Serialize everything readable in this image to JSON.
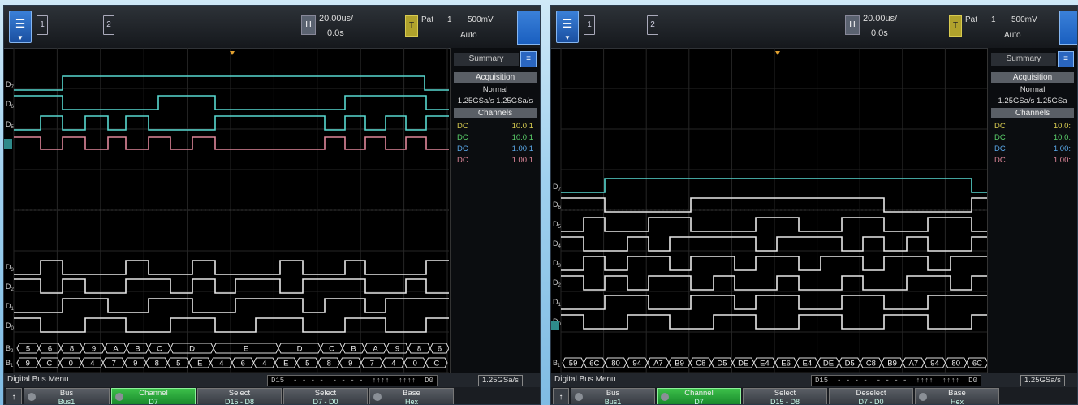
{
  "colors": {
    "d_high": "#58d8d0",
    "d_low_white": "#e8e8e8",
    "pink": "#e0879a",
    "ch1_yellow": "#d8cc50",
    "ch2_green": "#5acf6a",
    "ch3_blue": "#5aa8e8",
    "ch4_pink": "#e0879a"
  },
  "left": {
    "ch_tab1": "1",
    "ch_tab2": "2",
    "h_badge": "H",
    "h_timebase": "20.00us/",
    "h_delay": "0.0s",
    "t_badge": "T",
    "trig_type": "Pat",
    "trig_ch": "1",
    "trig_level": "500mV",
    "trig_mode": "Auto",
    "side": {
      "summary_tab": "Summary",
      "acq_head": "Acquisition",
      "acq_mode": "Normal",
      "acq_rate": "1.25GSa/s 1.25GSa/s",
      "chan_head": "Channels",
      "channels": [
        {
          "coupling": "DC",
          "probe": "10.0:1"
        },
        {
          "coupling": "DC",
          "probe": "10.0:1"
        },
        {
          "coupling": "DC",
          "probe": "1.00:1"
        },
        {
          "coupling": "DC",
          "probe": "1.00:1"
        }
      ]
    },
    "digital_labels_top": [
      "D7",
      "D6",
      "D5"
    ],
    "digital_labels_bottom": [
      "D3",
      "D2",
      "D1",
      "D0"
    ],
    "bus_labels": [
      "B2",
      "B1"
    ],
    "bus2_values": [
      "5",
      "6",
      "8",
      "9",
      "A",
      "B",
      "C",
      "D",
      "E",
      "D",
      "C",
      "B",
      "A",
      "9",
      "8",
      "6"
    ],
    "bus1_values": [
      "9",
      "C",
      "0",
      "4",
      "7",
      "9",
      "8",
      "5",
      "E",
      "4",
      "6",
      "4",
      "E",
      "5",
      "8",
      "9",
      "7",
      "4",
      "0",
      "C"
    ],
    "status_title": "Digital Bus Menu",
    "bitmap_left": "D15",
    "bitmap_mid": "- - - -  - - - -  ↑↑↑↑  ↑↑↑↑",
    "bitmap_right": "D0",
    "rate": "1.25GSa/s",
    "softkeys": [
      {
        "label": "Bus",
        "value": "Bus1"
      },
      {
        "label": "Channel",
        "value": "D7"
      },
      {
        "label": "Select",
        "value": "D15 - D8"
      },
      {
        "label": "Select",
        "value": "D7 - D0"
      },
      {
        "label": "Base",
        "value": "Hex"
      }
    ]
  },
  "right": {
    "ch_tab1": "1",
    "ch_tab2": "2",
    "h_badge": "H",
    "h_timebase": "20.00us/",
    "h_delay": "0.0s",
    "t_badge": "T",
    "trig_type": "Pat",
    "trig_ch": "1",
    "trig_level": "500mV",
    "trig_mode": "Auto",
    "side": {
      "summary_tab": "Summary",
      "acq_head": "Acquisition",
      "acq_mode": "Normal",
      "acq_rate": "1.25GSa/s 1.25GSa",
      "chan_head": "Channels",
      "channels": [
        {
          "coupling": "DC",
          "probe": "10.0:"
        },
        {
          "coupling": "DC",
          "probe": "10.0:"
        },
        {
          "coupling": "DC",
          "probe": "1.00:"
        },
        {
          "coupling": "DC",
          "probe": "1.00:"
        }
      ]
    },
    "digital_labels": [
      "D7",
      "D6",
      "D5",
      "D4",
      "D3",
      "D2",
      "D1",
      "D0"
    ],
    "bus_label": "B1",
    "bus_values": [
      "59",
      "6C",
      "80",
      "94",
      "A7",
      "B9",
      "C8",
      "D5",
      "DE",
      "E4",
      "E6",
      "E4",
      "DE",
      "D5",
      "C8",
      "B9",
      "A7",
      "94",
      "80",
      "6C"
    ],
    "status_title": "Digital Bus Menu",
    "bitmap_left": "D15",
    "bitmap_mid": "- - - -  - - - -  ↑↑↑↑  ↑↑↑↑",
    "bitmap_right": "D0",
    "rate": "1.25GSa/s",
    "softkeys": [
      {
        "label": "Bus",
        "value": "Bus1"
      },
      {
        "label": "Channel",
        "value": "D7"
      },
      {
        "label": "Select",
        "value": "D15 - D8"
      },
      {
        "label": "Deselect",
        "value": "D7 - D0"
      },
      {
        "label": "Base",
        "value": "Hex"
      }
    ]
  }
}
